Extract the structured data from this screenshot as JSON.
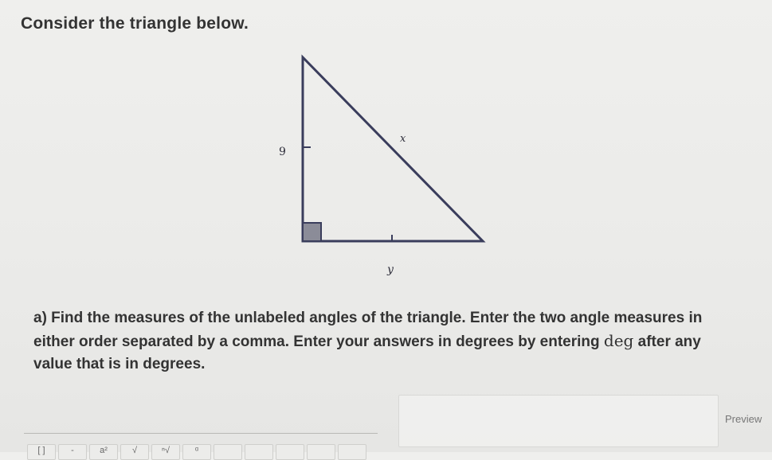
{
  "question": {
    "title": "Consider the triangle below.",
    "part_a_before_unit": "a) Find the measures of the unlabeled angles of the triangle. Enter the two angle measures in either order separated by a comma. Enter your answers in degrees by entering ",
    "unit": "deg",
    "part_a_after_unit": " after any value that is in degrees."
  },
  "figure": {
    "label_vertical_side": "9",
    "label_hypotenuse": "x",
    "label_bottom_side": "y"
  },
  "answer": {
    "value": "",
    "preview_label": "Preview"
  },
  "toolbar": {
    "buttons": [
      "[ ]",
      "-",
      "a²",
      "√",
      "ⁿ√",
      "ᵅ",
      "",
      "",
      "",
      "",
      ""
    ]
  },
  "colors": {
    "triangle_stroke": "#3a3d5c",
    "text": "#333333"
  }
}
